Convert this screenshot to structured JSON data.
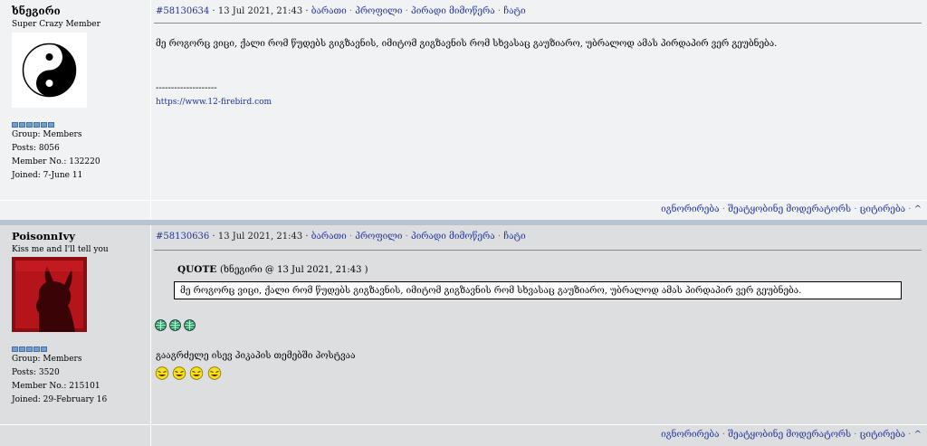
{
  "posts": [
    {
      "author": "ხნეგირი",
      "title": "Super Crazy Member",
      "group": "Group: Members",
      "posts": "Posts: 8056",
      "member_no": "Member No.: 132220",
      "joined": "Joined: 7-June 11",
      "pips": 6,
      "post_id": "#58130634",
      "timestamp": "· 13 Jul 2021, 21:43 ·",
      "links": [
        "ბარათი",
        "პროფილი",
        "პირადი მიმოწერა",
        "ჩატი"
      ],
      "body_line": "მე როგორც ვიცი, ქალი რომ წუდებს გიგზავნის, იმიტომ გიგზავნის რომ სხვასაც გაუზიარო, უბრალოდ ამას პირდაპირ ვერ გეუბნება.",
      "signature_rule": "--------------------",
      "signature_link": "https://www.12-firebird.com"
    },
    {
      "author": "PoisonnIvy",
      "title": "Kiss me and I'll tell you",
      "group": "Group: Members",
      "posts": "Posts: 3520",
      "member_no": "Member No.: 215101",
      "joined": "Joined: 29-February 16",
      "pips": 5,
      "post_id": "#58130636",
      "timestamp": "· 13 Jul 2021, 21:43 ·",
      "links": [
        "ბარათი",
        "პროფილი",
        "პირადი მიმოწერა",
        "ჩატი"
      ],
      "quote_label": "QUOTE",
      "quote_source": "(ხნეგირი @ 13 Jul 2021, 21:43 )",
      "quote_text": "მე როგორც ვიცი, ქალი რომ წუდებს გიგზავნის, იმიტომ გიგზავნის რომ სხვასაც გაუზიარო, უბრალოდ ამას პირდაპირ ვერ გეუბნება.",
      "body_line": "გააგრძელე ისევ პიკაპის თემებში პოსტვაა"
    }
  ],
  "footer": {
    "ignore": "იგნორირება",
    "report": "შეატყობინე მოდერატორს",
    "quote": "ციტირება",
    "up": "^"
  },
  "colors": {
    "link": "#223399",
    "post_bg_a": "#f0f2f3",
    "post_bg_b": "#dcdee0",
    "separator": "#b8c4d2"
  }
}
